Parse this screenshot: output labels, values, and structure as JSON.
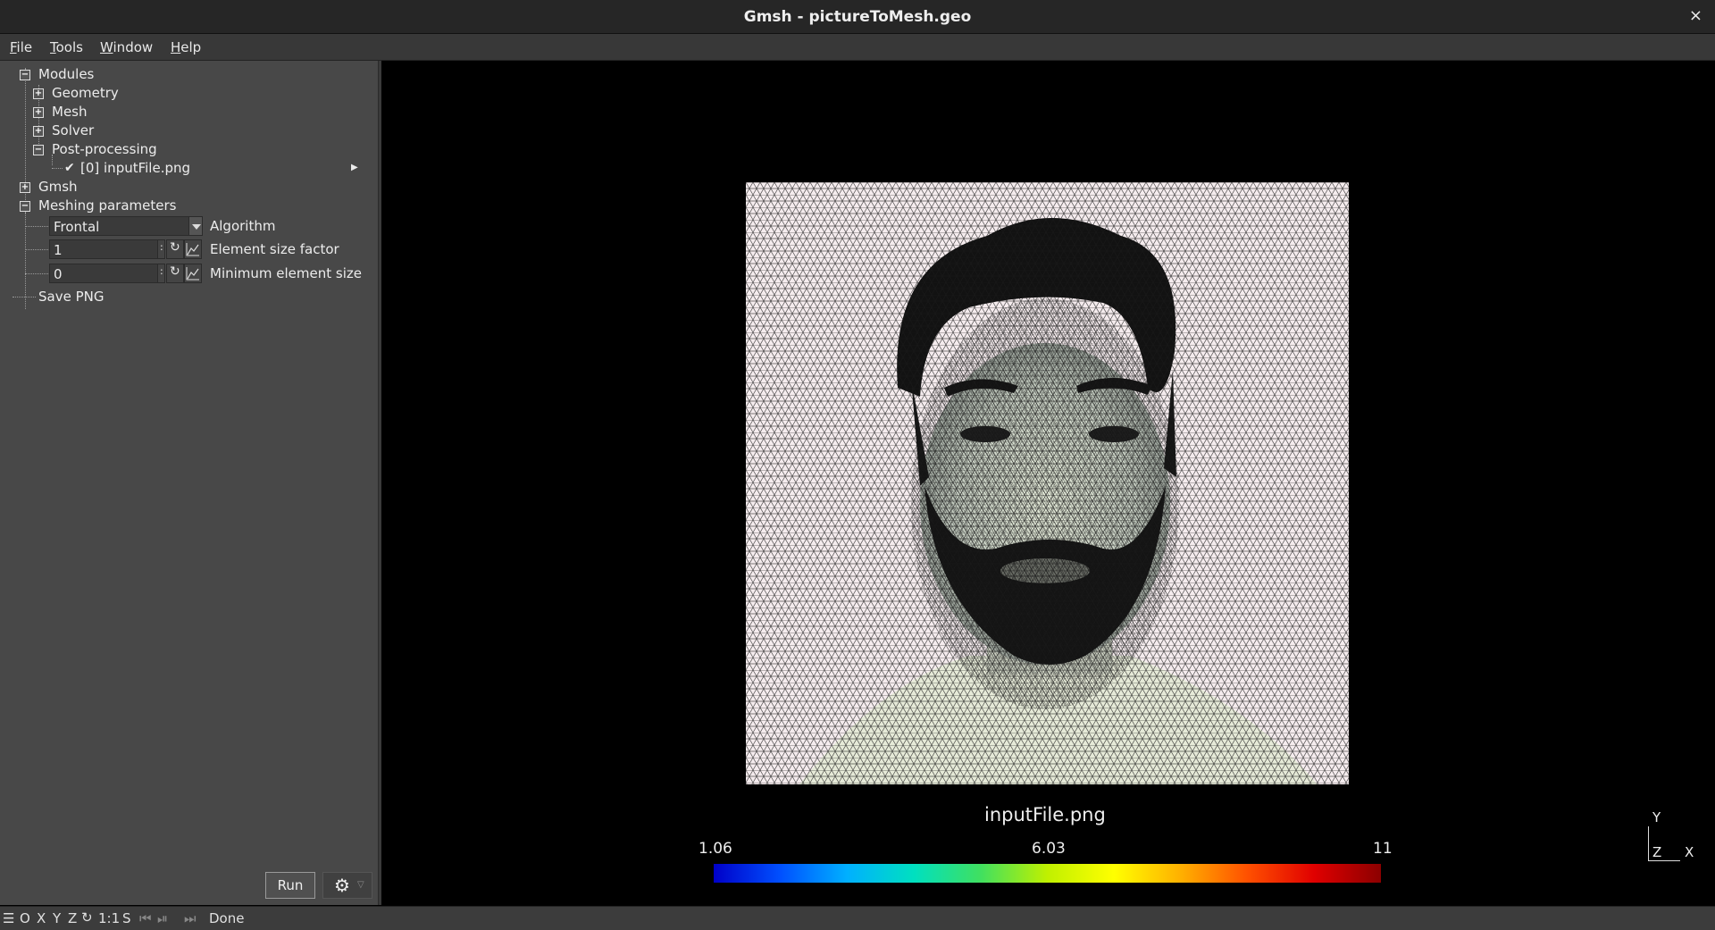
{
  "window": {
    "title": "Gmsh - pictureToMesh.geo",
    "close": "×"
  },
  "menu": [
    "File",
    "Tools",
    "Window",
    "Help"
  ],
  "tree": {
    "modules": "Modules",
    "geometry": "Geometry",
    "mesh": "Mesh",
    "solver": "Solver",
    "postprocessing": "Post-processing",
    "view": "[0] inputFile.png",
    "gmsh": "Gmsh",
    "meshing_parameters": "Meshing parameters",
    "save_png": "Save PNG"
  },
  "params": {
    "algorithm_value": "Frontal",
    "algorithm_label": "Algorithm",
    "size_factor_value": "1",
    "size_factor_label": "Element size factor",
    "min_size_value": "0",
    "min_size_label": "Minimum element size"
  },
  "buttons": {
    "run": "Run"
  },
  "viewport": {
    "view_name": "inputFile.png",
    "colorbar_min": "1.06",
    "colorbar_mid": "6.03",
    "colorbar_max": "11",
    "axis_y": "Y",
    "axis_z": "Z",
    "axis_x": "X"
  },
  "status": {
    "o": "O",
    "x": "X",
    "y": "Y",
    "z": "Z",
    "one_to_one": "1:1",
    "s": "S",
    "message": "Done"
  }
}
